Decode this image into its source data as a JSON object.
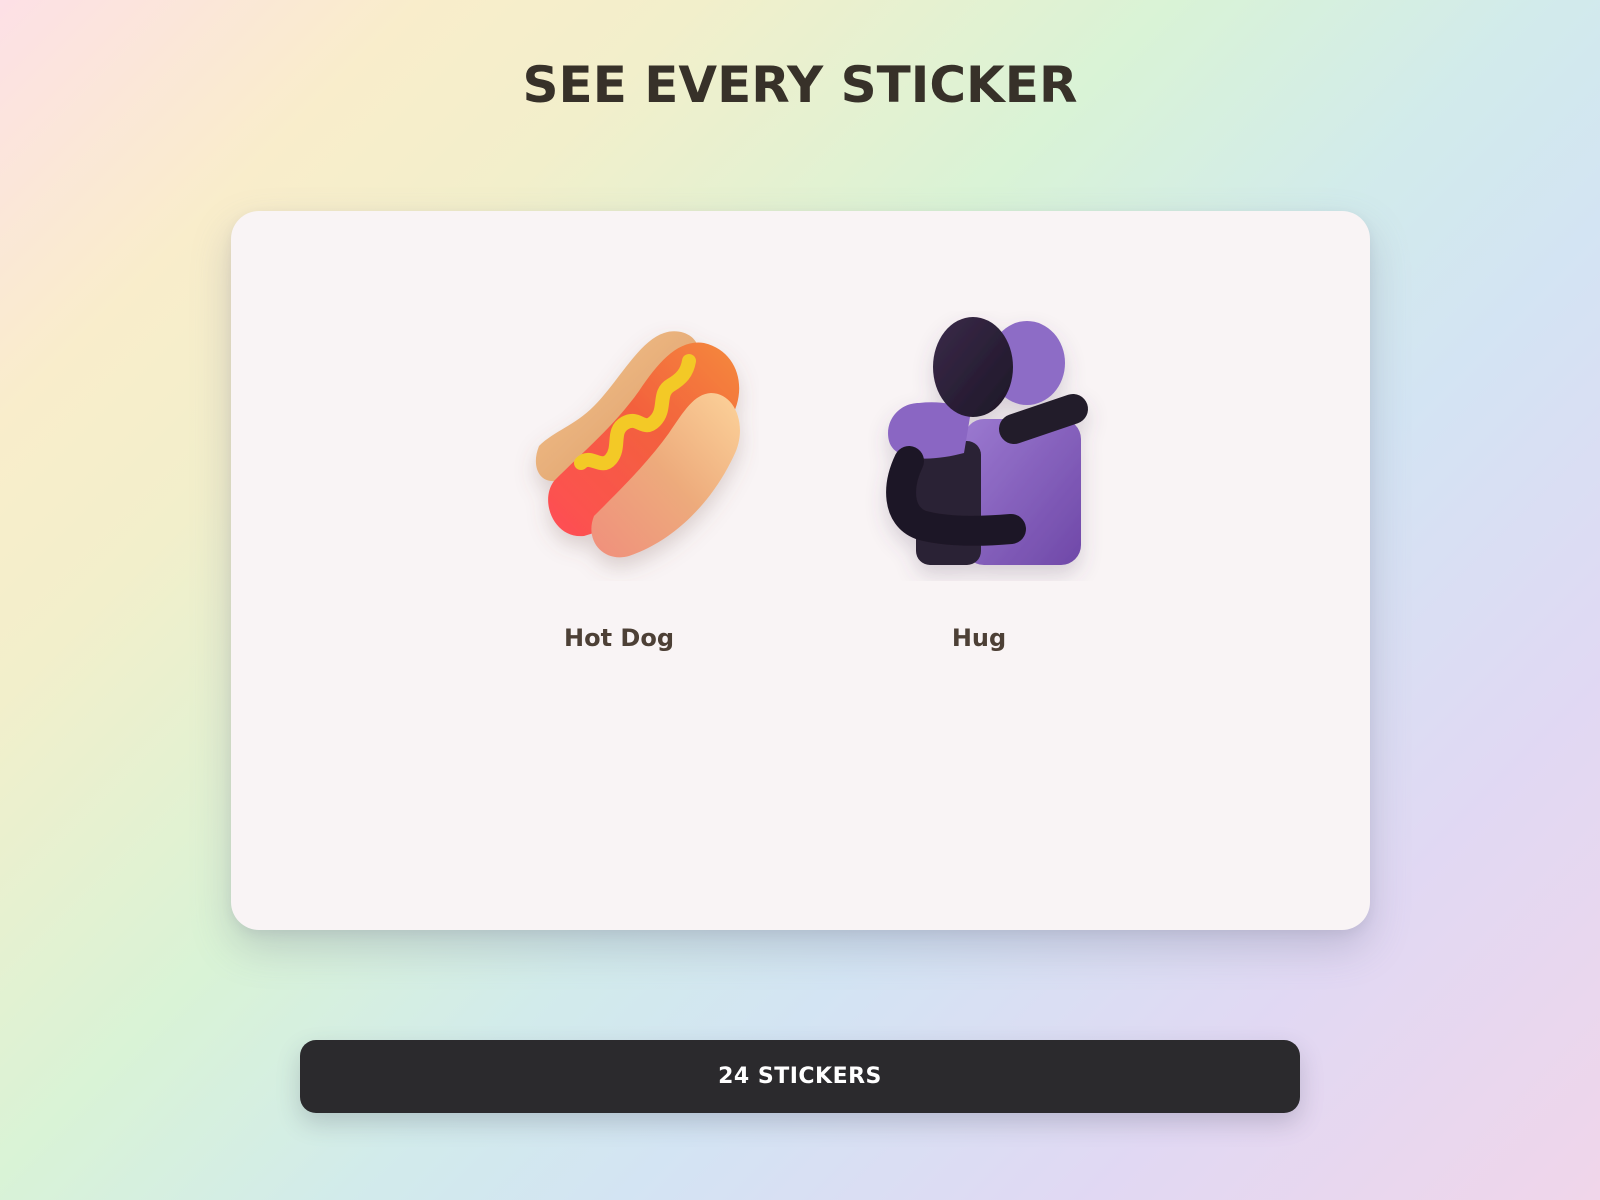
{
  "page": {
    "title": "SEE EVERY STICKER"
  },
  "stickers": [
    {
      "name": "Hot Dog",
      "icon": "hot-dog-icon"
    },
    {
      "name": "Hug",
      "icon": "people-hugging-icon"
    }
  ],
  "footer": {
    "count_label": "24 STICKERS"
  },
  "colors": {
    "title_text": "#373129",
    "card_background": "#f9f4f5",
    "sticker_label_text": "#4d4036",
    "button_background": "#2b2a2d",
    "button_text": "#ffffff"
  }
}
